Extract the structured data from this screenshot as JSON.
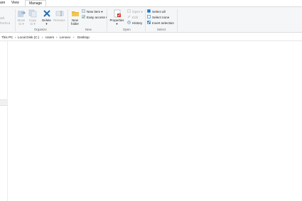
{
  "tabs": [
    {
      "label": "are"
    },
    {
      "label": "View"
    },
    {
      "label": "Manage"
    }
  ],
  "ribbon": {
    "clipboard": {
      "paste_shortcut_label": "ath",
      "shortcut_label": "hortcut"
    },
    "organize": {
      "label": "Organize",
      "move_to": {
        "line1": "Move",
        "line2": "to ▾"
      },
      "copy_to": {
        "line1": "Copy",
        "line2": "to ▾"
      },
      "delete": {
        "line1": "Delete",
        "line2": "▾"
      },
      "rename": "Rename"
    },
    "new": {
      "label": "New",
      "new_folder": {
        "line1": "New",
        "line2": "folder"
      },
      "new_item": "New item ▾",
      "easy_access": "Easy access ▾"
    },
    "open": {
      "label": "Open",
      "properties": {
        "line1": "Properties",
        "line2": "▾"
      },
      "open": "Open ▾",
      "edit": "Edit",
      "history": "History"
    },
    "select": {
      "label": "Select",
      "select_all": "Select all",
      "select_none": "Select none",
      "invert_selection": "Invert selection"
    }
  },
  "address": {
    "crumbs": [
      "This PC",
      "Local Disk (C:)",
      "Users",
      "Lenovo",
      "Desktop"
    ],
    "separator": "›"
  },
  "colors": {
    "accent": "#1979ca",
    "folder": "#e8b33c",
    "delete_red": "#d23b2c"
  }
}
